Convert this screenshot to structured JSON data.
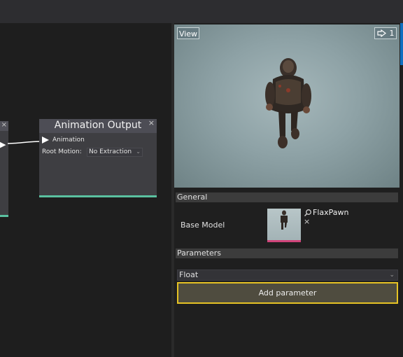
{
  "node": {
    "title": "Animation Output",
    "close": "×",
    "pin_label": "Animation",
    "root_motion_label": "Root Motion:",
    "root_motion_value": "No Extraction"
  },
  "node_left": {
    "close": "×"
  },
  "viewport": {
    "view_label": "View",
    "speed_value": "1"
  },
  "properties": {
    "general_header": "General",
    "base_model_label": "Base Model",
    "base_model_value": "FlaxPawn",
    "clear_glyph": "×",
    "parameters_header": "Parameters",
    "param_type": "Float",
    "add_parameter": "Add parameter"
  },
  "colors": {
    "accent_highlight": "#e6c224",
    "node_footer": "#5ac1a0",
    "thumb_bar": "#d0457a"
  }
}
